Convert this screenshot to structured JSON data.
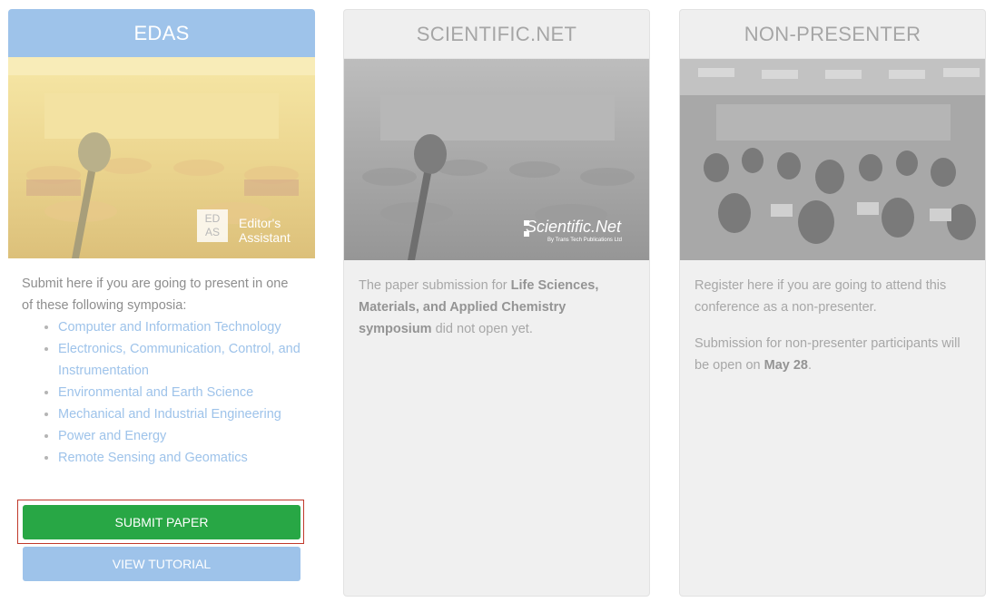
{
  "edas": {
    "title": "EDAS",
    "logo_mark": "ED AS",
    "logo_line1": "Editor's",
    "logo_line2": "Assistant",
    "intro": "Submit here if you are going to present in one of these following symposia:",
    "symposia": [
      "Computer and Information Technology",
      "Electronics, Communication, Control, and Instrumentation",
      "Environmental and Earth Science",
      "Mechanical and Industrial Engineering",
      "Power and Energy",
      "Remote Sensing and Geomatics"
    ],
    "submit_label": "SUBMIT PAPER",
    "tutorial_label": "VIEW TUTORIAL"
  },
  "scientific": {
    "title": "SCIENTIFIC.NET",
    "logo": "Scientific.Net",
    "logo_sub": "By Trans Tech Publications Ltd",
    "text_a": "The paper submission for ",
    "text_bold": "Life Sciences, Materials, and Applied Chemistry symposium",
    "text_b": " did not open yet."
  },
  "nonpresenter": {
    "title": "NON-PRESENTER",
    "para1": "Register here if you are going to attend this conference as a non-presenter.",
    "para2_a": "Submission for non-presenter participants will be open on ",
    "para2_bold": "May 28",
    "para2_b": "."
  },
  "colors": {
    "accent_blue": "#9ec3ea",
    "submit_green": "#28a745",
    "highlight_red": "#c0392b"
  }
}
